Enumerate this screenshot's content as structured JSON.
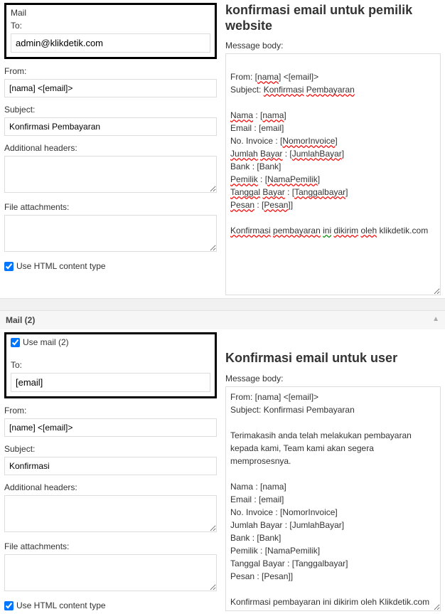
{
  "mail1": {
    "legend": "Mail",
    "to_label": "To:",
    "to_value": "admin@klikdetik.com",
    "from_label": "From:",
    "from_value": "[nama] <[email]>",
    "subject_label": "Subject:",
    "subject_value": "Konfirmasi Pembayaran",
    "headers_label": "Additional headers:",
    "headers_value": "",
    "attach_label": "File attachments:",
    "attach_value": "",
    "htmltype_label": "Use HTML content type"
  },
  "right1": {
    "heading": "konfirmasi email untuk pemilik website",
    "msg_label": "Message body:",
    "lines": {
      "l1a": "From: [",
      "l1b": "nama",
      "l1c": "] <[email]>",
      "l2a": "Subject: ",
      "l2b": "Konfirmasi",
      "l2c": " ",
      "l2d": "Pembayaran",
      "l3a": "Nama",
      "l3b": " : [",
      "l3c": "nama",
      "l3d": "]",
      "l4": "Email : [email]",
      "l5a": "No. Invoice : [",
      "l5b": "NomorInvoice",
      "l5c": "]",
      "l6a": "Jumlah",
      "l6b": " ",
      "l6c": "Bayar",
      "l6d": " : [",
      "l6e": "JumlahBayar",
      "l6f": "]",
      "l7": "Bank : [Bank]",
      "l8a": "Pemilik",
      "l8b": " : [",
      "l8c": "NamaPemilik",
      "l8d": "]",
      "l9a": "Tanggal",
      "l9b": " ",
      "l9c": "Bayar",
      "l9d": " : [",
      "l9e": "Tanggalbayar",
      "l9f": "]",
      "l10a": "Pesan",
      "l10b": " : [",
      "l10c": "Pesan",
      "l10d": "]]",
      "l11a": "Konfirmasi",
      "l11b": " ",
      "l11c": "pembayaran",
      "l11d": " ",
      "l11e": "ini",
      "l11f": " ",
      "l11g": "dikirim",
      "l11h": " ",
      "l11i": "oleh",
      "l11j": " klikdetik.com"
    }
  },
  "header2": "Mail (2)",
  "mail2": {
    "usemail_label": "Use mail (2)",
    "to_label": "To:",
    "to_value": "[email]",
    "from_label": "From:",
    "from_value": "[name] <[email]>",
    "subject_label": "Subject:",
    "subject_value": "Konfirmasi",
    "headers_label": "Additional headers:",
    "headers_value": "",
    "attach_label": "File attachments:",
    "attach_value": "",
    "htmltype_label": "Use HTML content type"
  },
  "right2": {
    "heading": "Konfirmasi email untuk user",
    "msg_label": "Message body:",
    "body": "From: [nama] <[email]>\nSubject: Konfirmasi Pembayaran\n\nTerimakasih anda telah melakukan pembayaran kepada kami, Team kami akan segera memprosesnya.\n\nNama : [nama]\nEmail : [email]\nNo. Invoice : [NomorInvoice]\nJumlah Bayar : [JumlahBayar]\nBank : [Bank]\nPemilik : [NamaPemilik]\nTanggal Bayar : [Tanggalbayar]\nPesan : [Pesan]]\n\nKonfirmasi pembayaran ini dikirim oleh Klikdetik.com"
  },
  "collapse_glyph": "▲"
}
